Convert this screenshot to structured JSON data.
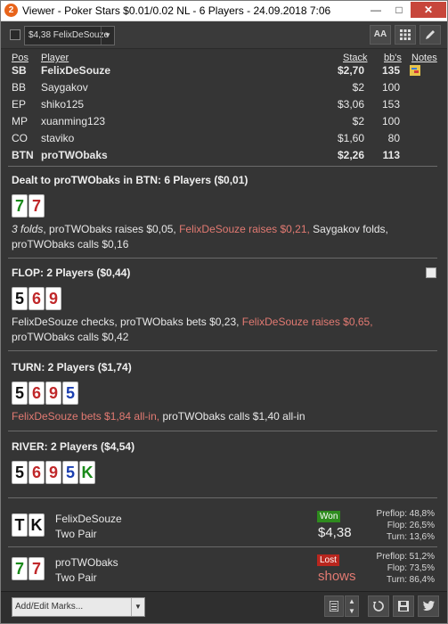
{
  "window": {
    "title": "Viewer - Poker Stars $0.01/0.02 NL - 6 Players - 24.09.2018 7:06",
    "app_icon": "2"
  },
  "toolbar": {
    "player_select": "$4,38 FelixDeSouze",
    "font_button": "AA",
    "grid_button": "grid-icon",
    "edit_button": "pencil-icon"
  },
  "table": {
    "headers": {
      "pos": "Pos",
      "player": "Player",
      "stack": "Stack",
      "bbs": "bb's",
      "notes": "Notes"
    },
    "rows": [
      {
        "pos": "SB",
        "player": "FelixDeSouze",
        "stack": "$2,70",
        "bbs": "135",
        "bold": true,
        "note": true
      },
      {
        "pos": "BB",
        "player": "Saygakov",
        "stack": "$2",
        "bbs": "100",
        "bold": false
      },
      {
        "pos": "EP",
        "player": "shiko125",
        "stack": "$3,06",
        "bbs": "153",
        "bold": false
      },
      {
        "pos": "MP",
        "player": "xuanming123",
        "stack": "$2",
        "bbs": "100",
        "bold": false
      },
      {
        "pos": "CO",
        "player": "staviko",
        "stack": "$1,60",
        "bbs": "80",
        "bold": false
      },
      {
        "pos": "BTN",
        "player": "proTWObaks",
        "stack": "$2,26",
        "bbs": "113",
        "bold": true
      }
    ]
  },
  "preflop": {
    "heading": "Dealt to proTWObaks in BTN: 6 Players ($0,01)",
    "cards": [
      {
        "rank": "7",
        "color": "#1a8a1a"
      },
      {
        "rank": "7",
        "color": "#c0282a"
      }
    ],
    "a1": "3 folds",
    "a2": ", proTWObaks raises $0,05, ",
    "a3": "FelixDeSouze raises $0,21, ",
    "a4": "Saygakov folds,",
    "line2": "proTWObaks calls $0,16"
  },
  "flop": {
    "heading": "FLOP: 2 Players ($0,44)",
    "cards": [
      {
        "rank": "5",
        "color": "#111111"
      },
      {
        "rank": "6",
        "color": "#c0282a"
      },
      {
        "rank": "9",
        "color": "#c0282a"
      }
    ],
    "a1": "FelixDeSouze checks, proTWObaks bets $0,23, ",
    "a2": "FelixDeSouze raises $0,65,",
    "line2": "proTWObaks calls $0,42"
  },
  "turn": {
    "heading": "TURN: 2 Players ($1,74)",
    "cards": [
      {
        "rank": "5",
        "color": "#111111"
      },
      {
        "rank": "6",
        "color": "#c0282a"
      },
      {
        "rank": "9",
        "color": "#c0282a"
      },
      {
        "rank": "5",
        "color": "#1b3fb0"
      }
    ],
    "a1": "FelixDeSouze bets $1,84 all-in, ",
    "a2": "proTWObaks calls $1,40 all-in"
  },
  "river": {
    "heading": "RIVER: 2 Players ($4,54)",
    "cards": [
      {
        "rank": "5",
        "color": "#111111"
      },
      {
        "rank": "6",
        "color": "#c0282a"
      },
      {
        "rank": "9",
        "color": "#c0282a"
      },
      {
        "rank": "5",
        "color": "#1b3fb0"
      },
      {
        "rank": "K",
        "color": "#1a8a1a"
      }
    ]
  },
  "showdown": [
    {
      "cards": [
        {
          "rank": "T",
          "color": "#111111"
        },
        {
          "rank": "K",
          "color": "#111111"
        }
      ],
      "name": "FelixDeSouze",
      "hand": "Two Pair",
      "result": "Won",
      "result_color": "#2e8b1e",
      "amount": "$4,38",
      "preflop": "48,8%",
      "flop": "26,5%",
      "turn": "13,6%"
    },
    {
      "cards": [
        {
          "rank": "7",
          "color": "#1a8a1a"
        },
        {
          "rank": "7",
          "color": "#c0282a"
        }
      ],
      "name": "proTWObaks",
      "hand": "Two Pair",
      "result": "Lost",
      "result_color": "#b8261e",
      "amount": "shows",
      "preflop": "51,2%",
      "flop": "73,5%",
      "turn": "86,4%"
    }
  ],
  "equity_labels": {
    "preflop": "Preflop:",
    "flop": "Flop:",
    "turn": "Turn:"
  },
  "bottom": {
    "marks_placeholder": "Add/Edit Marks..."
  }
}
